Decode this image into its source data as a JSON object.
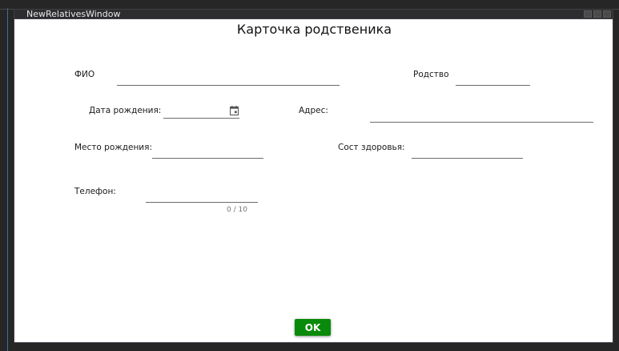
{
  "window": {
    "caption": "NewRelativesWindow",
    "title": "Карточка родственика"
  },
  "form": {
    "fio_label": "ФИО",
    "fio_value": "",
    "relation_label": "Родство",
    "relation_value": "",
    "birthdate_label": "Дата рождения:",
    "birthdate_value": "",
    "address_label": "Адрес:",
    "address_value": "",
    "birthplace_label": "Место рождения:",
    "birthplace_value": "",
    "health_label": "Сост здоровья:",
    "health_value": "",
    "phone_label": "Телефон:",
    "phone_value": "",
    "phone_counter": "0 / 10"
  },
  "actions": {
    "ok_label": "OK"
  },
  "colors": {
    "ok_button": "#0a8a0a",
    "window_bg": "#ffffff",
    "chrome_bg": "#2d2d30"
  },
  "icons": {
    "calendar": "calendar-icon"
  }
}
